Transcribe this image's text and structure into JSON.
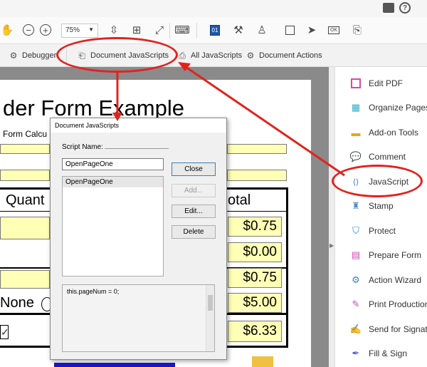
{
  "topbar": {
    "icons": [
      "comment-icon",
      "help-icon"
    ]
  },
  "toolbar": {
    "zoom_value": "75%",
    "zoom_arrow": "▼"
  },
  "secondary_toolbar": {
    "debugger": "Debugger",
    "document_javascripts": "Document JavaScripts",
    "all_javascripts": "All JavaScripts",
    "document_actions": "Document Actions"
  },
  "document": {
    "title": "der Form Example",
    "subtitle": "Form Calcu",
    "col_quantity": "Quant",
    "col_total": "otal",
    "none_label": "None",
    "totals": [
      "$0.75",
      "$0.00",
      "$0.75",
      "$5.00",
      "$6.33"
    ]
  },
  "dialog": {
    "title": "Document JavaScripts",
    "script_name_label": "Script Name:",
    "script_name_value": "OpenPageOne",
    "list_items": [
      "OpenPageOne"
    ],
    "buttons": {
      "close": "Close",
      "add": "Add...",
      "edit": "Edit...",
      "delete": "Delete"
    },
    "code": "this.pageNum = 0;"
  },
  "right_pane": {
    "tools": [
      {
        "label": "Edit PDF",
        "color": "#d44aa8"
      },
      {
        "label": "Organize Pages",
        "color": "#2bb0c8"
      },
      {
        "label": "Add-on Tools",
        "color": "#e8a520"
      },
      {
        "label": "Comment",
        "color": "#f2b622"
      },
      {
        "label": "JavaScript",
        "color": "#2b6fcf"
      },
      {
        "label": "Stamp",
        "color": "#4a8bd4"
      },
      {
        "label": "Protect",
        "color": "#2b7fd0"
      },
      {
        "label": "Prepare Form",
        "color": "#c84bb0"
      },
      {
        "label": "Action Wizard",
        "color": "#3a7fd0"
      },
      {
        "label": "Print Production",
        "color": "#c84bb0"
      },
      {
        "label": "Send for Signature",
        "color": "#4a6fc4"
      },
      {
        "label": "Fill & Sign",
        "color": "#5a5fc0"
      }
    ]
  },
  "colors": {
    "annotation": "#e1231e",
    "field_fill": "#ffffb5"
  }
}
